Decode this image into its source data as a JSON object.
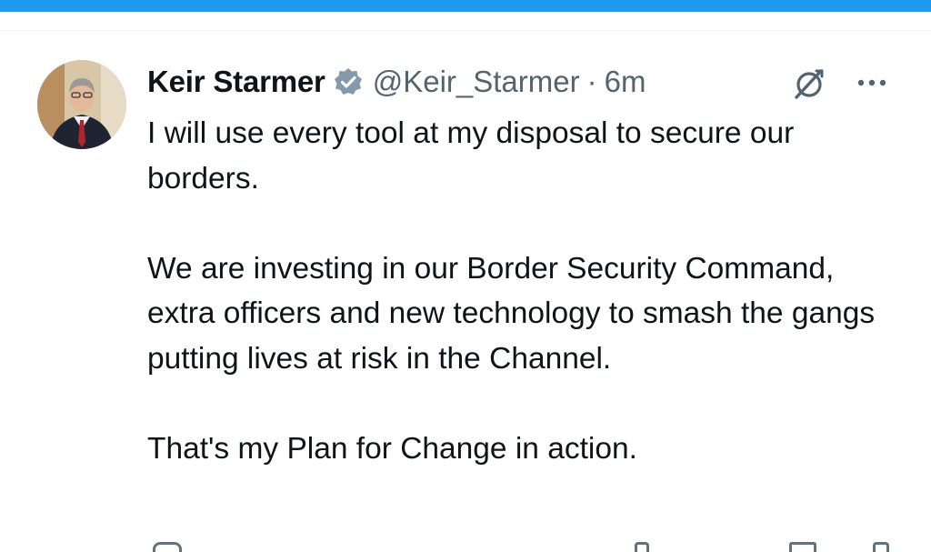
{
  "tweet": {
    "author": {
      "display_name": "Keir Starmer",
      "handle": "@Keir_Starmer",
      "verified": true
    },
    "separator": "·",
    "timestamp": "6m",
    "paragraphs": [
      "I will use every tool at my disposal to secure our borders.",
      "We are investing in our Border Security Command, extra officers and new technology to smash the gangs putting lives at risk in the Channel.",
      "That's my Plan for Change in action."
    ]
  },
  "icons": {
    "verified": "verified-badge-icon",
    "grok": "grok-icon",
    "more": "more-options-icon",
    "reply": "reply-icon",
    "views": "views-icon",
    "bookmark": "bookmark-icon",
    "share": "share-icon"
  },
  "colors": {
    "accent": "#1d9bf0",
    "text": "#0f1419",
    "secondary_text": "#536471",
    "divider": "#eff3f4",
    "verified_badge": "#829aab"
  }
}
